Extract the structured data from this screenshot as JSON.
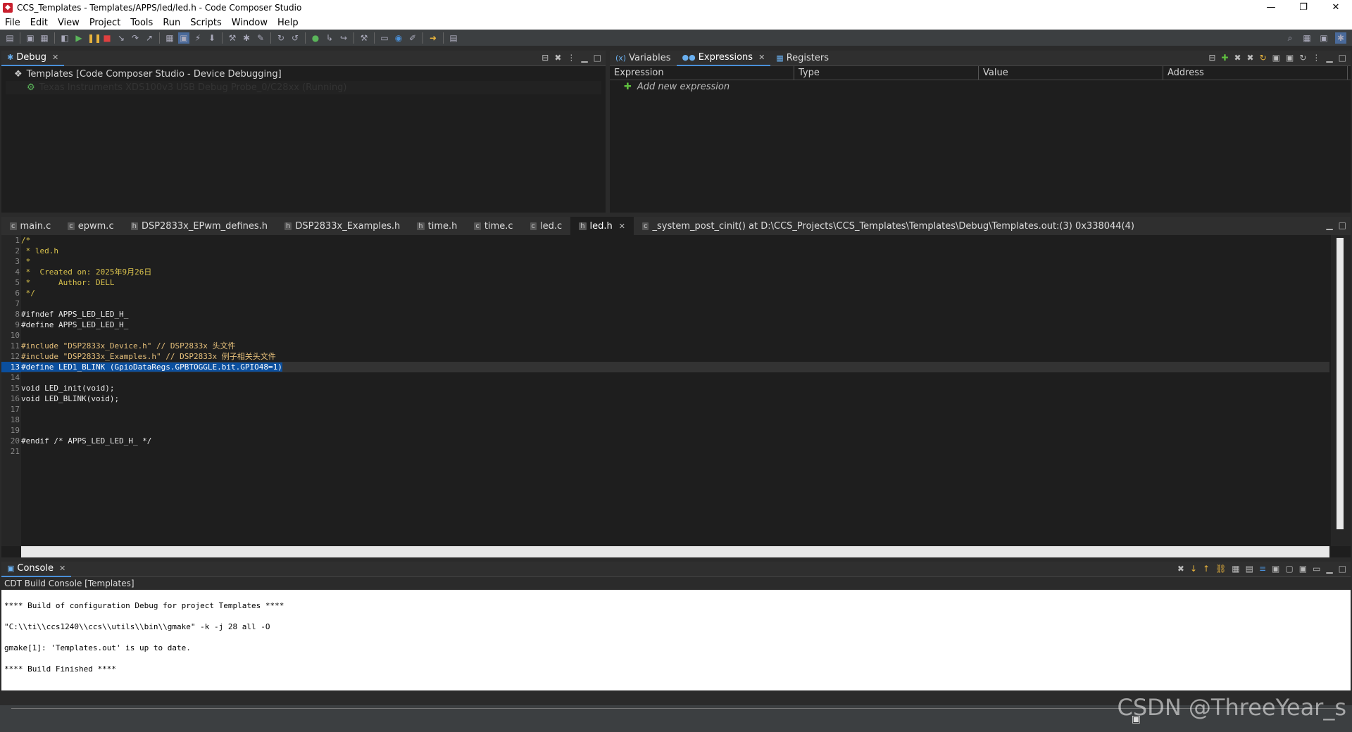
{
  "window": {
    "title": "CCS_Templates - Templates/APPS/led/led.h - Code Composer Studio",
    "controls": [
      "—",
      "❐",
      "✕"
    ]
  },
  "menu": [
    "File",
    "Edit",
    "View",
    "Project",
    "Tools",
    "Run",
    "Scripts",
    "Window",
    "Help"
  ],
  "debug": {
    "tab_label": "Debug",
    "tree": [
      {
        "label": "Templates [Code Composer Studio - Device Debugging]"
      },
      {
        "label": "Texas Instruments XDS100v3 USB Debug Probe_0/C28xx (Running)"
      }
    ]
  },
  "expressions": {
    "tabs": [
      "Variables",
      "Expressions",
      "Registers"
    ],
    "active_tab": "Expressions",
    "columns": [
      "Expression",
      "Type",
      "Value",
      "Address"
    ],
    "add_label": "Add new expression"
  },
  "editor": {
    "tabs": [
      {
        "label": "main.c",
        "icon": "c"
      },
      {
        "label": "epwm.c",
        "icon": "c"
      },
      {
        "label": "DSP2833x_EPwm_defines.h",
        "icon": "h"
      },
      {
        "label": "DSP2833x_Examples.h",
        "icon": "h"
      },
      {
        "label": "time.h",
        "icon": "h"
      },
      {
        "label": "time.c",
        "icon": "c"
      },
      {
        "label": "led.c",
        "icon": "c"
      },
      {
        "label": "led.h",
        "icon": "h",
        "active": true
      },
      {
        "label": "_system_post_cinit() at D:\\CCS_Projects\\CCS_Templates\\Templates\\Debug\\Templates.out:(3) 0x338044(4)",
        "icon": "c"
      }
    ],
    "lines": [
      {
        "n": "1",
        "text": "/*"
      },
      {
        "n": "2",
        "text": " * led.h"
      },
      {
        "n": "3",
        "text": " *"
      },
      {
        "n": "4",
        "text": " *  Created on: 2025年9月26日"
      },
      {
        "n": "5",
        "text": " *      Author: DELL"
      },
      {
        "n": "6",
        "text": " */"
      },
      {
        "n": "7",
        "text": ""
      },
      {
        "n": "8",
        "text": "#ifndef APPS_LED_LED_H_"
      },
      {
        "n": "9",
        "text": "#define APPS_LED_LED_H_"
      },
      {
        "n": "10",
        "text": ""
      },
      {
        "n": "11",
        "text": "#include \"DSP2833x_Device.h\" // DSP2833x 头文件"
      },
      {
        "n": "12",
        "text": "#include \"DSP2833x_Examples.h\" // DSP2833x 例子相关头文件"
      },
      {
        "n": "13",
        "text": "#define LED1_BLINK (GpioDataRegs.GPBTOGGLE.bit.GPIO48=1)"
      },
      {
        "n": "14",
        "text": ""
      },
      {
        "n": "15",
        "text": "void LED_init(void);"
      },
      {
        "n": "16",
        "text": "void LED_BLINK(void);"
      },
      {
        "n": "17",
        "text": ""
      },
      {
        "n": "18",
        "text": ""
      },
      {
        "n": "19",
        "text": ""
      },
      {
        "n": "20",
        "text": "#endif /* APPS_LED_LED_H_ */"
      },
      {
        "n": "21",
        "text": ""
      }
    ]
  },
  "console": {
    "tab_label": "Console",
    "sub_title": "CDT Build Console [Templates]",
    "lines": [
      "**** Build of configuration Debug for project Templates ****",
      "\"C:\\\\ti\\\\ccs1240\\\\ccs\\\\utils\\\\bin\\\\gmake\" -k -j 28 all -O",
      "gmake[1]: 'Templates.out' is up to date.",
      "**** Build Finished ****"
    ]
  },
  "watermark": "CSDN @ThreeYear_s"
}
